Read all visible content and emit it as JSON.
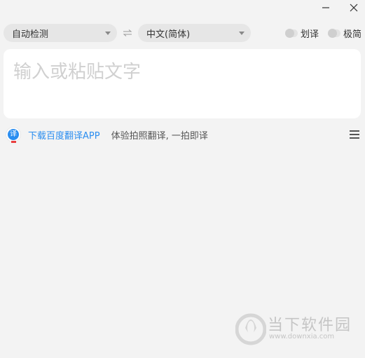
{
  "titlebar": {
    "minimize_icon": "minimize-icon",
    "close_icon": "close-icon"
  },
  "languages": {
    "source": "自动检测",
    "target": "中文(简体)",
    "swap_icon": "swap-arrows-icon"
  },
  "toggles": {
    "huayi_label": "划译",
    "jijian_label": "极简"
  },
  "input": {
    "value": "",
    "placeholder": "输入或粘贴文字"
  },
  "promo": {
    "link_text": "下载百度翻译APP",
    "description": "体验拍照翻译, 一拍即译",
    "icon_glyph": "译"
  },
  "watermark": {
    "name": "当下软件园",
    "url": "www.downxia.com"
  },
  "colors": {
    "background": "#f3f3f3",
    "accent": "#2b8ef0",
    "input_bg": "#ffffff",
    "select_bg": "#e6e6e6"
  }
}
